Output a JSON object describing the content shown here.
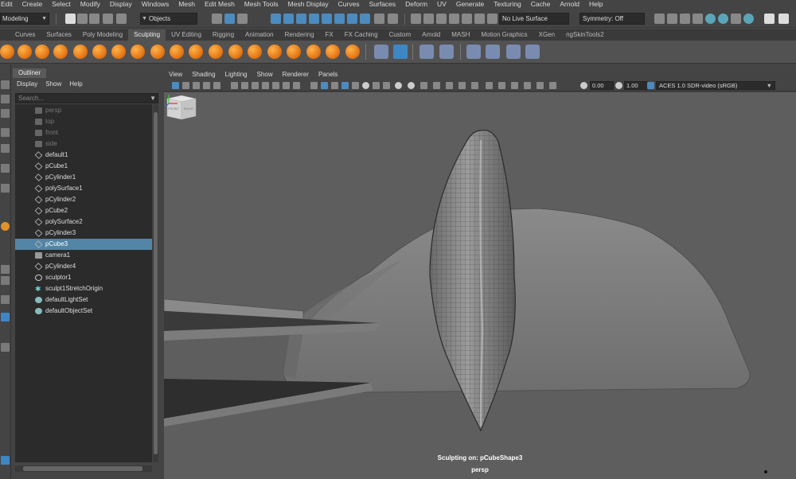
{
  "menubar": {
    "items": [
      "Edit",
      "Create",
      "Select",
      "Modify",
      "Display",
      "Windows",
      "Mesh",
      "Edit Mesh",
      "Mesh Tools",
      "Mesh Display",
      "Curves",
      "Surfaces",
      "Deform",
      "UV",
      "Generate",
      "Texturing",
      "Cache",
      "Arnold",
      "Help"
    ]
  },
  "statusline": {
    "mode": "Modeling",
    "selection_mask": "Objects",
    "live_surface": "No Live Surface",
    "symmetry": "Symmetry: Off"
  },
  "shelf": {
    "tabs": [
      "Curves",
      "Surfaces",
      "Poly Modeling",
      "Sculpting",
      "UV Editing",
      "Rigging",
      "Animation",
      "Rendering",
      "FX",
      "FX Caching",
      "Custom",
      "Arnold",
      "MASH",
      "Motion Graphics",
      "XGen",
      "ngSkinTools2"
    ],
    "active_tab": "Sculpting"
  },
  "outliner": {
    "title": "Outliner",
    "menu": [
      "Display",
      "Show",
      "Help"
    ],
    "search_placeholder": "Search...",
    "items": [
      {
        "label": "persp",
        "icon": "camera-icon",
        "dim": true
      },
      {
        "label": "top",
        "icon": "camera-icon",
        "dim": true
      },
      {
        "label": "front",
        "icon": "camera-icon",
        "dim": true
      },
      {
        "label": "side",
        "icon": "camera-icon",
        "dim": true
      },
      {
        "label": "default1",
        "icon": "mesh-icon"
      },
      {
        "label": "pCube1",
        "icon": "mesh-icon"
      },
      {
        "label": "pCylinder1",
        "icon": "mesh-icon"
      },
      {
        "label": "polySurface1",
        "icon": "mesh-icon"
      },
      {
        "label": "pCylinder2",
        "icon": "mesh-icon"
      },
      {
        "label": "pCube2",
        "icon": "mesh-icon"
      },
      {
        "label": "polySurface2",
        "icon": "mesh-icon"
      },
      {
        "label": "pCylinder3",
        "icon": "mesh-icon"
      },
      {
        "label": "pCube3",
        "icon": "mesh-icon",
        "selected": true
      },
      {
        "label": "camera1",
        "icon": "camera-icon"
      },
      {
        "label": "pCylinder4",
        "icon": "mesh-icon"
      },
      {
        "label": "sculptor1",
        "icon": "sculptor-icon"
      },
      {
        "label": "sculpt1StretchOrigin",
        "icon": "star-icon"
      },
      {
        "label": "defaultLightSet",
        "icon": "set-icon"
      },
      {
        "label": "defaultObjectSet",
        "icon": "set-icon"
      }
    ]
  },
  "viewport": {
    "menu": [
      "View",
      "Shading",
      "Lighting",
      "Show",
      "Renderer",
      "Panels"
    ],
    "exposure": "0.00",
    "gamma": "1.00",
    "color_space": "ACES 1.0 SDR-video (sRGB)",
    "viewcube_front": "FRONT",
    "viewcube_right": "RIGHT",
    "hud_sculpt": "Sculpting on: pCubeShape3",
    "camera_name": "persp"
  },
  "colors": {
    "selection": "#5285a6",
    "tool_orange": "#e07010",
    "viewport_bg": "#5e5e5e"
  }
}
